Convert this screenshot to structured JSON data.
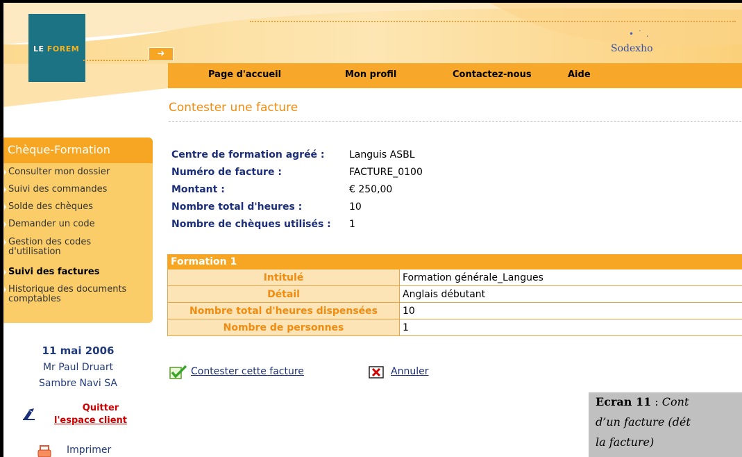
{
  "colors": {
    "accent": "#f6a623",
    "teal": "#1c7384",
    "navy": "#1c2f7a",
    "red": "#d00000",
    "caption_bg": "#c0c0c0"
  },
  "header": {
    "logo": {
      "part1": "LE ",
      "part2": "FOREM"
    },
    "arrow": "➜",
    "sodexho": "Sodexho",
    "sodexho_dots": "• ˙ ."
  },
  "nav": {
    "items": [
      "Page d'accueil",
      "Mon profil",
      "Contactez-nous",
      "Aide"
    ]
  },
  "page": {
    "title": "Contester une facture"
  },
  "sidebar": {
    "title": "Chèque-Formation",
    "items": [
      "Consulter mon dossier",
      "Suivi des commandes",
      "Solde des chèques",
      "Demander un code",
      "Gestion des codes d'utilisation",
      "Suivi des factures",
      "Historique des documents comptables"
    ],
    "active_item": "Suivi des factures"
  },
  "user": {
    "date": "11 mai 2006",
    "name": "Mr Paul Druart",
    "company": "Sambre Navi SA",
    "quit_line1": "Quitter",
    "quit_line2": "l'espace client",
    "print_label": "Imprimer"
  },
  "invoice": {
    "rows": [
      {
        "label": "Centre de formation agréé :",
        "value": "Languis ASBL"
      },
      {
        "label": "Numéro de facture :",
        "value": "FACTURE_0100"
      },
      {
        "label": "Montant :",
        "value": "€ 250,00"
      },
      {
        "label": "Nombre total d'heures :",
        "value": "10"
      },
      {
        "label": "Nombre de chèques utilisés :",
        "value": "1"
      }
    ]
  },
  "formation": {
    "header": "Formation 1",
    "rows": [
      {
        "label": "Intitulé",
        "value": "Formation générale_Langues"
      },
      {
        "label": "Détail",
        "value": "Anglais débutant"
      },
      {
        "label": "Nombre total d'heures dispensées",
        "value": "10"
      },
      {
        "label": "Nombre de personnes",
        "value": "1"
      }
    ]
  },
  "actions": {
    "contest": "Contester cette facture",
    "cancel": "Annuler"
  },
  "caption": {
    "bold": "Ecran 11",
    "sep": " : ",
    "line1_rest": "Cont",
    "line2": "d’un facture (dét",
    "line3": "la facture)"
  }
}
